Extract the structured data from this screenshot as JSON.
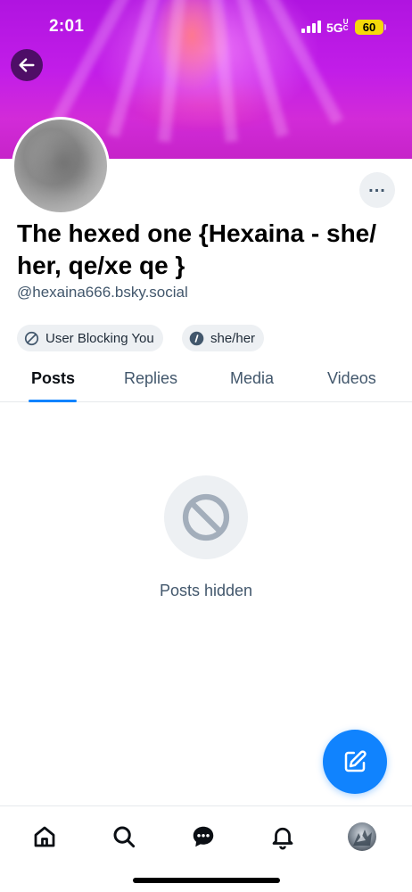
{
  "status_bar": {
    "time": "2:01",
    "network": "5G",
    "network_suffix": "UC",
    "battery": "60",
    "battery_color": "#f5d90a"
  },
  "profile": {
    "display_name": "The hexed one {Hexaina - she/ her, qe/xe qe }",
    "handle": "@hexaina666.bsky.social",
    "badges": [
      {
        "label": "User Blocking You",
        "icon": "block-icon"
      },
      {
        "label": "she/her",
        "icon": "info-icon"
      }
    ]
  },
  "tabs": [
    {
      "label": "Posts",
      "active": true
    },
    {
      "label": "Replies",
      "active": false
    },
    {
      "label": "Media",
      "active": false
    },
    {
      "label": "Videos",
      "active": false
    }
  ],
  "empty_state": {
    "message": "Posts hidden",
    "icon": "block-icon"
  },
  "fab": {
    "icon": "compose-icon"
  },
  "bottom_nav": [
    {
      "name": "home",
      "icon": "home-icon"
    },
    {
      "name": "search",
      "icon": "search-icon"
    },
    {
      "name": "messages",
      "icon": "chat-icon"
    },
    {
      "name": "notifications",
      "icon": "bell-icon"
    },
    {
      "name": "profile",
      "icon": "avatar"
    }
  ],
  "colors": {
    "accent": "#1083fe",
    "text_secondary": "#42576c",
    "pill_bg": "#edf0f3"
  }
}
